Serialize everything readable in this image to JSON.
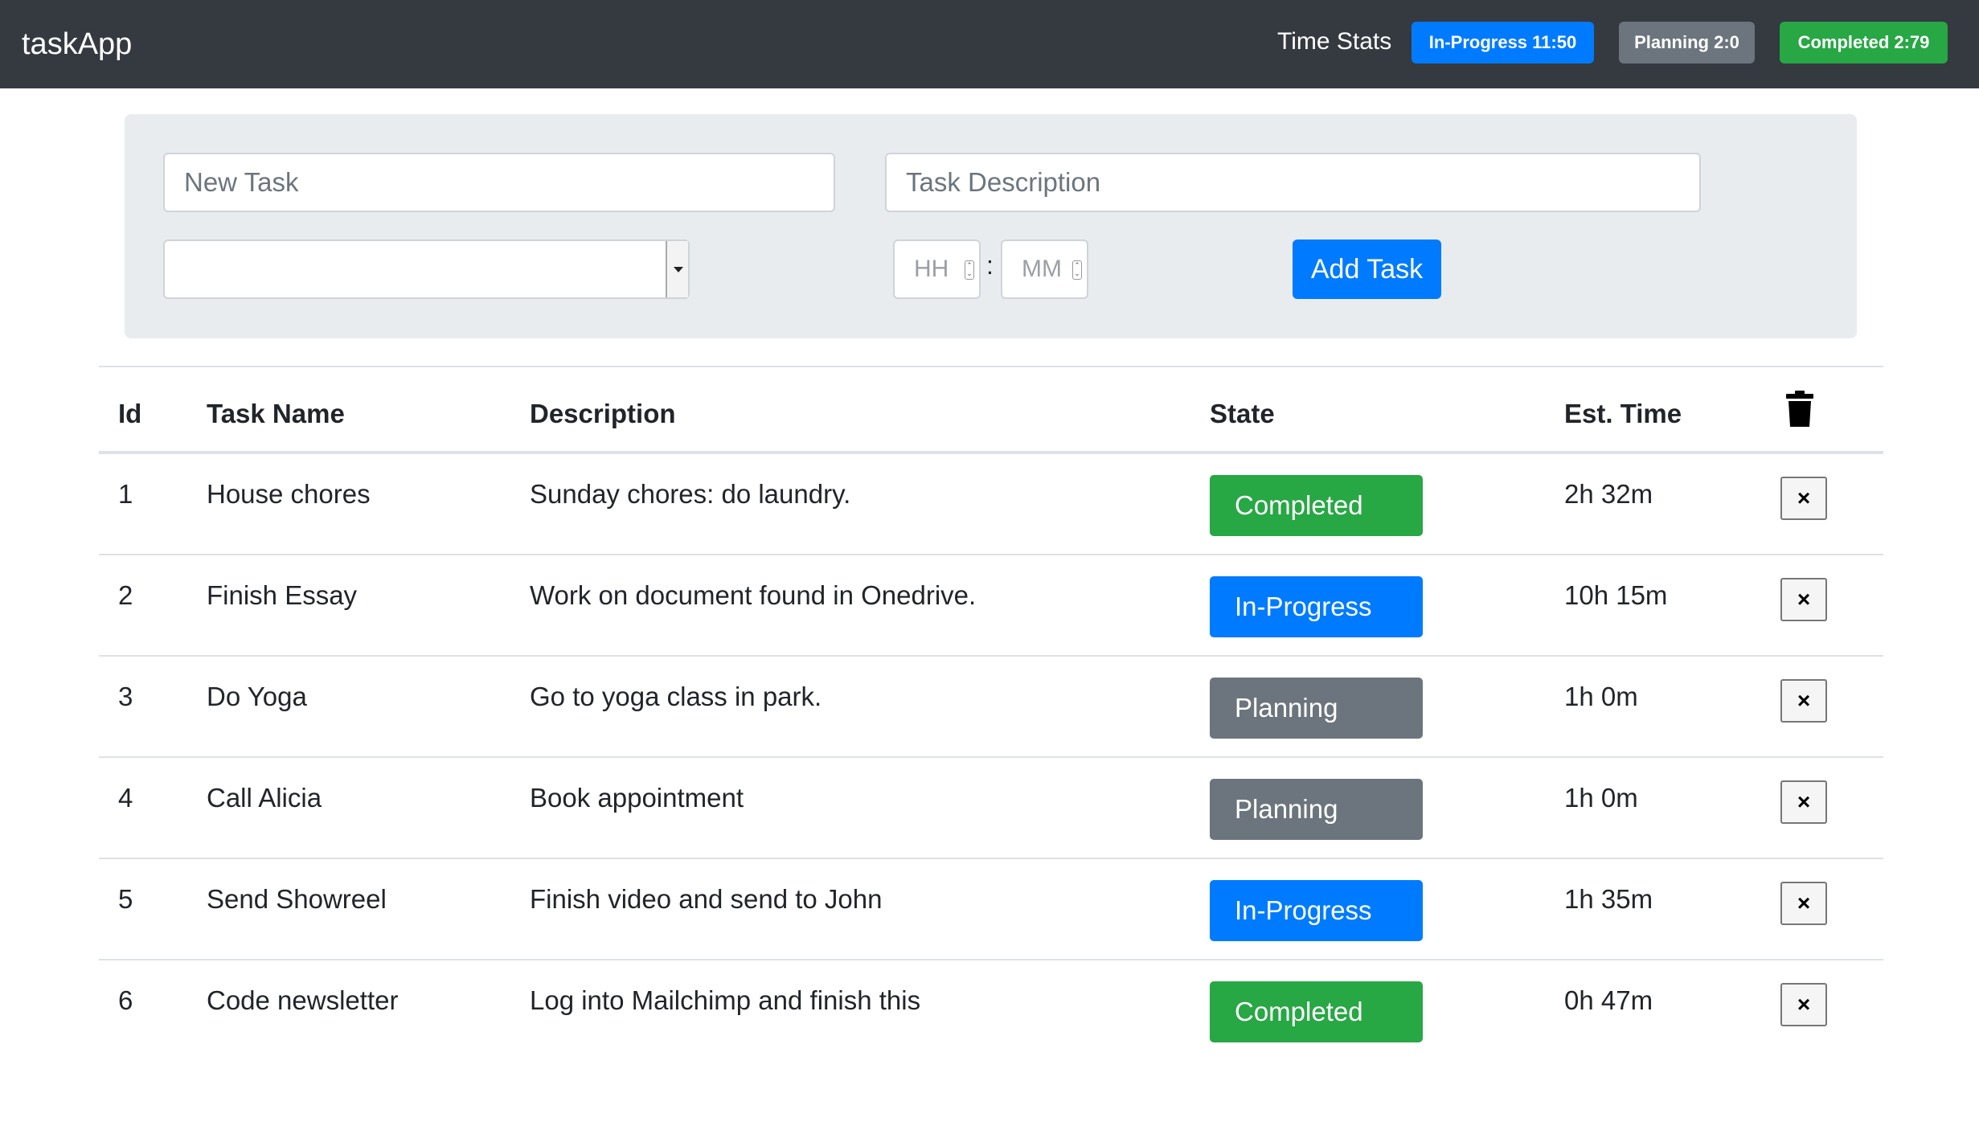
{
  "navbar": {
    "brand": "taskApp",
    "stats_label": "Time Stats",
    "badges": {
      "in_progress": "In-Progress 11:50",
      "planning": "Planning 2:0",
      "completed": "Completed 2:79"
    }
  },
  "form": {
    "task_placeholder": "New Task",
    "description_placeholder": "Task Description",
    "select_value": "",
    "hours_placeholder": "HH",
    "minutes_placeholder": "MM",
    "separator": ":",
    "add_button": "Add Task"
  },
  "table": {
    "headers": {
      "id": "Id",
      "name": "Task Name",
      "description": "Description",
      "state": "State",
      "time": "Est. Time",
      "delete_all_icon": "trash-icon"
    },
    "rows": [
      {
        "id": "1",
        "name": "House chores",
        "description": "Sunday chores: do laundry.",
        "state": "Completed",
        "time": "2h 32m"
      },
      {
        "id": "2",
        "name": "Finish Essay",
        "description": "Work on document found in Onedrive.",
        "state": "In-Progress",
        "time": "10h 15m"
      },
      {
        "id": "3",
        "name": "Do Yoga",
        "description": "Go to yoga class in park.",
        "state": "Planning",
        "time": "1h 0m"
      },
      {
        "id": "4",
        "name": "Call Alicia",
        "description": "Book appointment",
        "state": "Planning",
        "time": "1h 0m"
      },
      {
        "id": "5",
        "name": "Send Showreel",
        "description": "Finish video and send to John",
        "state": "In-Progress",
        "time": "1h 35m"
      },
      {
        "id": "6",
        "name": "Code newsletter",
        "description": "Log into Mailchimp and finish this",
        "state": "Completed",
        "time": "0h 47m"
      }
    ],
    "delete_label": "×"
  },
  "colors": {
    "navbar": "#343a40",
    "primary": "#007bff",
    "secondary": "#6c757d",
    "success": "#28a745",
    "panel": "#e9ecef"
  }
}
